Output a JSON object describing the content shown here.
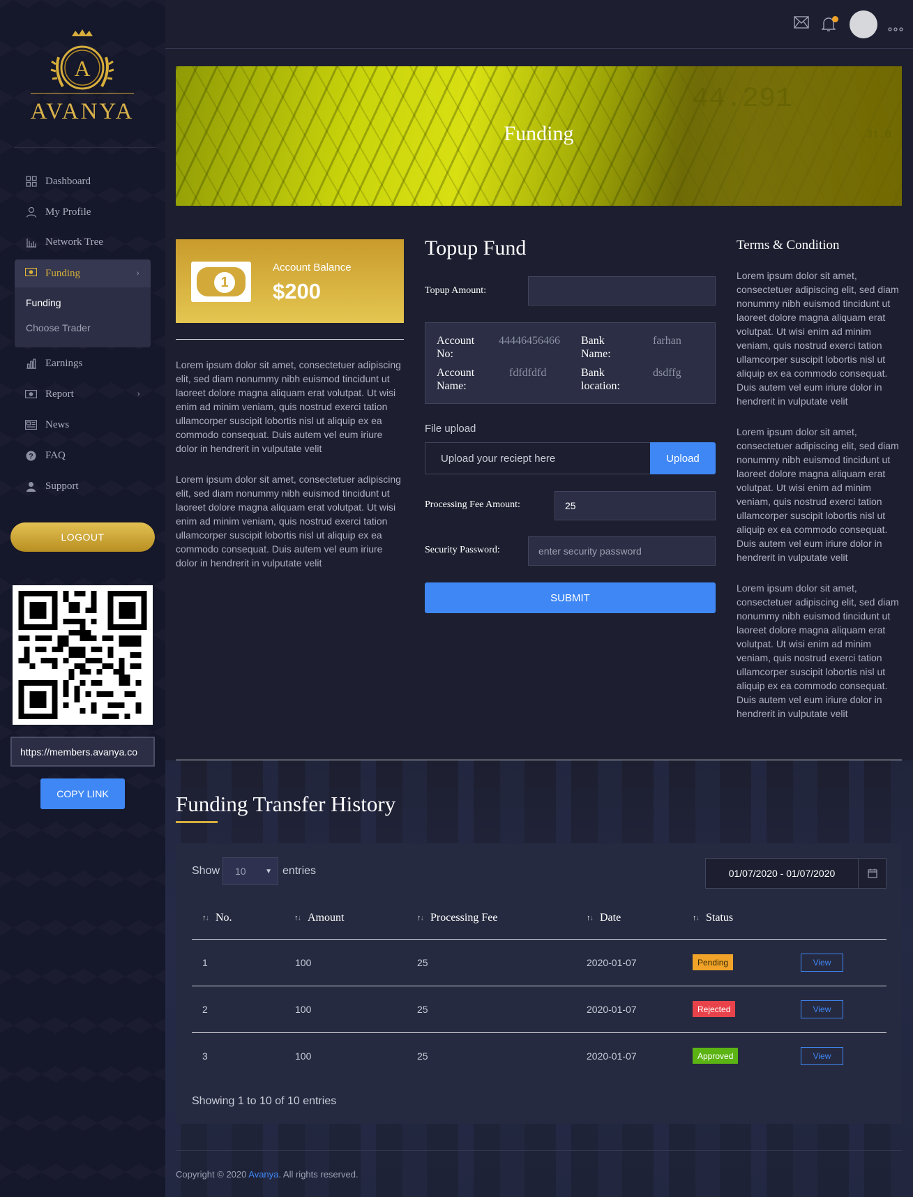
{
  "brand": {
    "logo_letter": "A",
    "name": "AVANYA"
  },
  "sidebar": {
    "items": [
      {
        "label": "Dashboard",
        "icon": "grid-icon"
      },
      {
        "label": "My Profile",
        "icon": "user-icon"
      },
      {
        "label": "Network Tree",
        "icon": "network-icon"
      },
      {
        "label": "Funding",
        "icon": "money-icon"
      },
      {
        "label": "Earnings",
        "icon": "bar-chart-icon"
      },
      {
        "label": "Report",
        "icon": "report-icon"
      },
      {
        "label": "News",
        "icon": "newspaper-icon"
      },
      {
        "label": "FAQ",
        "icon": "question-icon"
      },
      {
        "label": "Support",
        "icon": "support-icon"
      }
    ],
    "funding_sub": [
      "Funding",
      "Choose Trader"
    ],
    "logout_label": "LOGOUT",
    "referral_link": "https://members.avanya.co",
    "copy_label": "COPY LINK"
  },
  "banner": {
    "title": "Funding",
    "bg_text_1": "44.291",
    "bg_text_2": "31.0"
  },
  "balance": {
    "label": "Account Balance",
    "value": "$200",
    "bill_symbol": "1"
  },
  "left_paragraphs": [
    "Lorem ipsum dolor sit amet, consectetuer adipiscing elit, sed diam nonummy nibh euismod tincidunt ut laoreet dolore magna aliquam erat volutpat. Ut wisi enim ad minim veniam, quis nostrud exerci tation ullamcorper suscipit lobortis nisl ut aliquip ex ea commodo consequat. Duis autem vel eum iriure dolor in hendrerit in vulputate velit",
    "Lorem ipsum dolor sit amet, consectetuer adipiscing elit, sed diam nonummy nibh euismod tincidunt ut laoreet dolore magna aliquam erat volutpat. Ut wisi enim ad minim veniam, quis nostrud exerci tation ullamcorper suscipit lobortis nisl ut aliquip ex ea commodo consequat. Duis autem vel eum iriure dolor in hendrerit in vulputate velit"
  ],
  "topup": {
    "title": "Topup Fund",
    "amount_label": "Topup Amount:",
    "amount_value": "",
    "bank": {
      "account_no_label": "Account No:",
      "account_no": "44446456466",
      "bank_name_label": "Bank Name:",
      "bank_name": "farhan",
      "account_name_label": "Account Name:",
      "account_name": "fdfdfdfd",
      "bank_location_label": "Bank location:",
      "bank_location": "dsdffg"
    },
    "file_label": "File upload",
    "file_placeholder": "Upload your reciept here",
    "upload_label": "Upload",
    "fee_label": "Processing Fee Amount:",
    "fee_value": "25",
    "password_label": "Security Password:",
    "password_placeholder": "enter security password",
    "submit_label": "SUBMIT"
  },
  "terms": {
    "title": "Terms & Condition",
    "paragraphs": [
      "Lorem ipsum dolor sit amet, consectetuer adipiscing elit, sed diam nonummy nibh euismod tincidunt ut laoreet dolore magna aliquam erat volutpat. Ut wisi enim ad minim veniam, quis nostrud exerci tation ullamcorper suscipit lobortis nisl ut aliquip ex ea commodo consequat. Duis autem vel eum iriure dolor in hendrerit in vulputate velit",
      "Lorem ipsum dolor sit amet, consectetuer adipiscing elit, sed diam nonummy nibh euismod tincidunt ut laoreet dolore magna aliquam erat volutpat. Ut wisi enim ad minim veniam, quis nostrud exerci tation ullamcorper suscipit lobortis nisl ut aliquip ex ea commodo consequat. Duis autem vel eum iriure dolor in hendrerit in vulputate velit",
      "Lorem ipsum dolor sit amet, consectetuer adipiscing elit, sed diam nonummy nibh euismod tincidunt ut laoreet dolore magna aliquam erat volutpat. Ut wisi enim ad minim veniam, quis nostrud exerci tation ullamcorper suscipit lobortis nisl ut aliquip ex ea commodo consequat. Duis autem vel eum iriure dolor in hendrerit in vulputate velit"
    ]
  },
  "history": {
    "title": "Funding Transfer History",
    "show_label": "Show",
    "entries_value": "10",
    "entries_label": "entries",
    "date_range": "01/07/2020 - 01/07/2020",
    "columns": [
      "No.",
      "Amount",
      "Processing Fee",
      "Date",
      "Status"
    ],
    "rows": [
      {
        "no": "1",
        "amount": "100",
        "fee": "25",
        "date": "2020-01-07",
        "status": "Pending",
        "status_color": "#f0a328",
        "action": "View"
      },
      {
        "no": "2",
        "amount": "100",
        "fee": "25",
        "date": "2020-01-07",
        "status": "Rejected",
        "status_color": "#e8434b",
        "action": "View"
      },
      {
        "no": "3",
        "amount": "100",
        "fee": "25",
        "date": "2020-01-07",
        "status": "Approved",
        "status_color": "#5cb414",
        "action": "View"
      }
    ],
    "showing_text": "Showing 1 to 10 of 10 entries"
  },
  "footer": {
    "prefix": "Copyright © 2020 ",
    "brand": "Avanya",
    "suffix": ". All rights reserved."
  },
  "colors": {
    "accent_gold": "#d7ae3c",
    "accent_blue": "#3f87f5",
    "bg": "#1d1f30",
    "sidebar_bg": "#15172a"
  }
}
